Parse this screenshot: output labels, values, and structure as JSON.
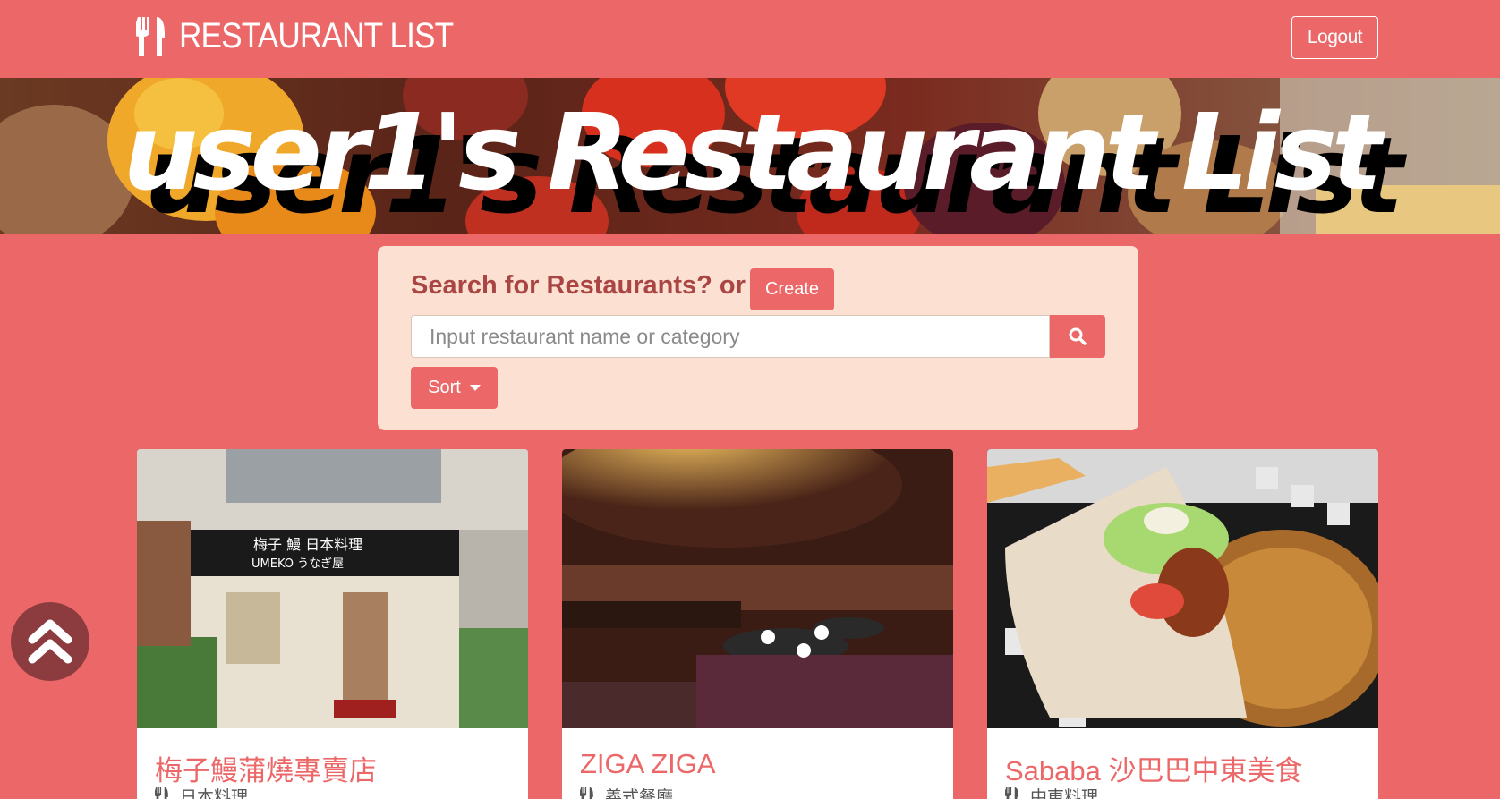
{
  "navbar": {
    "brand": "RESTAURANT LIST",
    "logout_label": "Logout"
  },
  "banner": {
    "title": "user1's Restaurant List"
  },
  "search": {
    "heading": "Search for Restaurants? or",
    "create_label": "Create",
    "placeholder": "Input restaurant name or category",
    "value": "",
    "sort_label": "Sort"
  },
  "restaurants": [
    {
      "name": "梅子鰻蒲燒專賣店",
      "category": "日本料理"
    },
    {
      "name": "ZIGA ZIGA",
      "category": "義式餐廳"
    },
    {
      "name": "Sababa 沙巴巴中東美食",
      "category": "中東料理"
    }
  ],
  "icons": {
    "brand": "utensils-icon",
    "search": "search-icon",
    "sort": "caret-down-icon",
    "category": "utensils-icon",
    "back_to_top": "double-chevron-up-icon"
  },
  "colors": {
    "background": "#ec6868",
    "card": "#fce1d3",
    "heading": "#a94644",
    "accent": "#ec6868",
    "back_to_top": "#8c3c3f"
  }
}
